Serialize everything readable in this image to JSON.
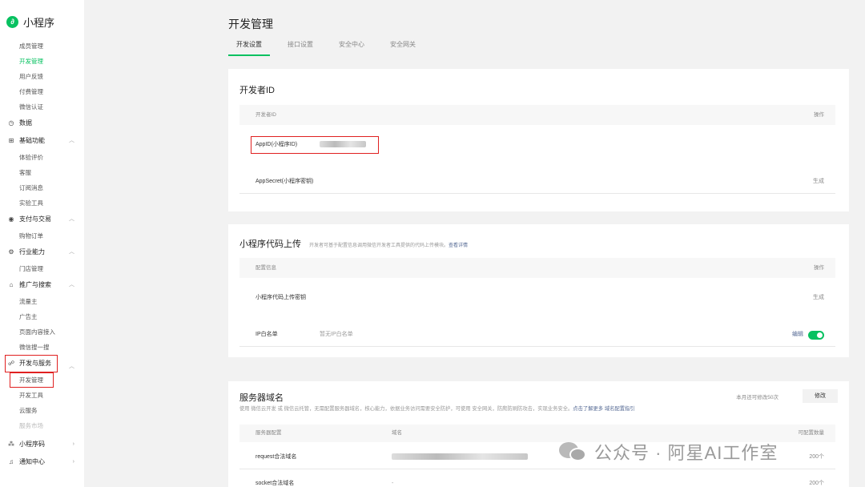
{
  "app": {
    "name": "小程序",
    "logo_glyph": "∂"
  },
  "sidebar": {
    "top_items": [
      {
        "label": "成员管理"
      },
      {
        "label": "开发管理"
      },
      {
        "label": "用户反馈"
      },
      {
        "label": "付费管理"
      },
      {
        "label": "微信认证"
      }
    ],
    "section_data": {
      "label": "数据",
      "icon": "clock-icon"
    },
    "section_basic": {
      "label": "基础功能",
      "items": [
        "体验评价",
        "客服",
        "订阅消息",
        "实验工具"
      ]
    },
    "section_pay": {
      "label": "支付与交易",
      "items": [
        "购物订单"
      ]
    },
    "section_industry": {
      "label": "行业能力",
      "items": [
        "门店管理"
      ]
    },
    "section_promo": {
      "label": "推广与搜索",
      "items": [
        "流量主",
        "广告主",
        "页面内容接入",
        "微信搜一搜"
      ]
    },
    "section_dev": {
      "label": "开发与服务",
      "items": [
        "开发管理",
        "开发工具",
        "云服务",
        "服务市场"
      ]
    },
    "bottom_code": {
      "label": "小程序码"
    },
    "bottom_notify": {
      "label": "通知中心"
    }
  },
  "main": {
    "title": "开发管理",
    "tabs": [
      "开发设置",
      "接口设置",
      "安全中心",
      "安全网关"
    ],
    "developer_id": {
      "title": "开发者ID",
      "header_col1": "开发者ID",
      "header_op": "操作",
      "appid_label": "AppID(小程序ID)",
      "appsecret_label": "AppSecret(小程序密钥)",
      "appsecret_action": "生成"
    },
    "code_upload": {
      "title": "小程序代码上传",
      "desc": "开发者可基于配置信息调用微信开发者工具提供的代码上传模块。",
      "desc_link": "查看详情",
      "header_col1": "配置信息",
      "header_op": "操作",
      "key_label": "小程序代码上传密钥",
      "key_action": "生成",
      "ip_label": "IP白名单",
      "ip_value": "暂无IP白名单",
      "ip_edit": "编辑",
      "ip_switch_on": true
    },
    "server_domain": {
      "title": "服务器域名",
      "quota": "本月还可修改50次",
      "modify_label": "修改",
      "desc": "使用 微信云开发 或 微信云托管，无需配置服务器域名，核心能力，依据业务访问需要安全防护，可使用 安全网关，防爬防刷防攻击，实现业务安全。",
      "desc_link": "点击了解更多 域名配置指引",
      "header_col1": "服务器配置",
      "header_col2": "域名",
      "header_col3": "可配置数量",
      "rows": [
        {
          "type": "request合法域名",
          "domain": "",
          "count": "200个"
        },
        {
          "type": "socket合法域名",
          "domain": "-",
          "count": "200个"
        }
      ]
    }
  },
  "watermark": {
    "text": "公众号 · 阿星AI工作室"
  }
}
